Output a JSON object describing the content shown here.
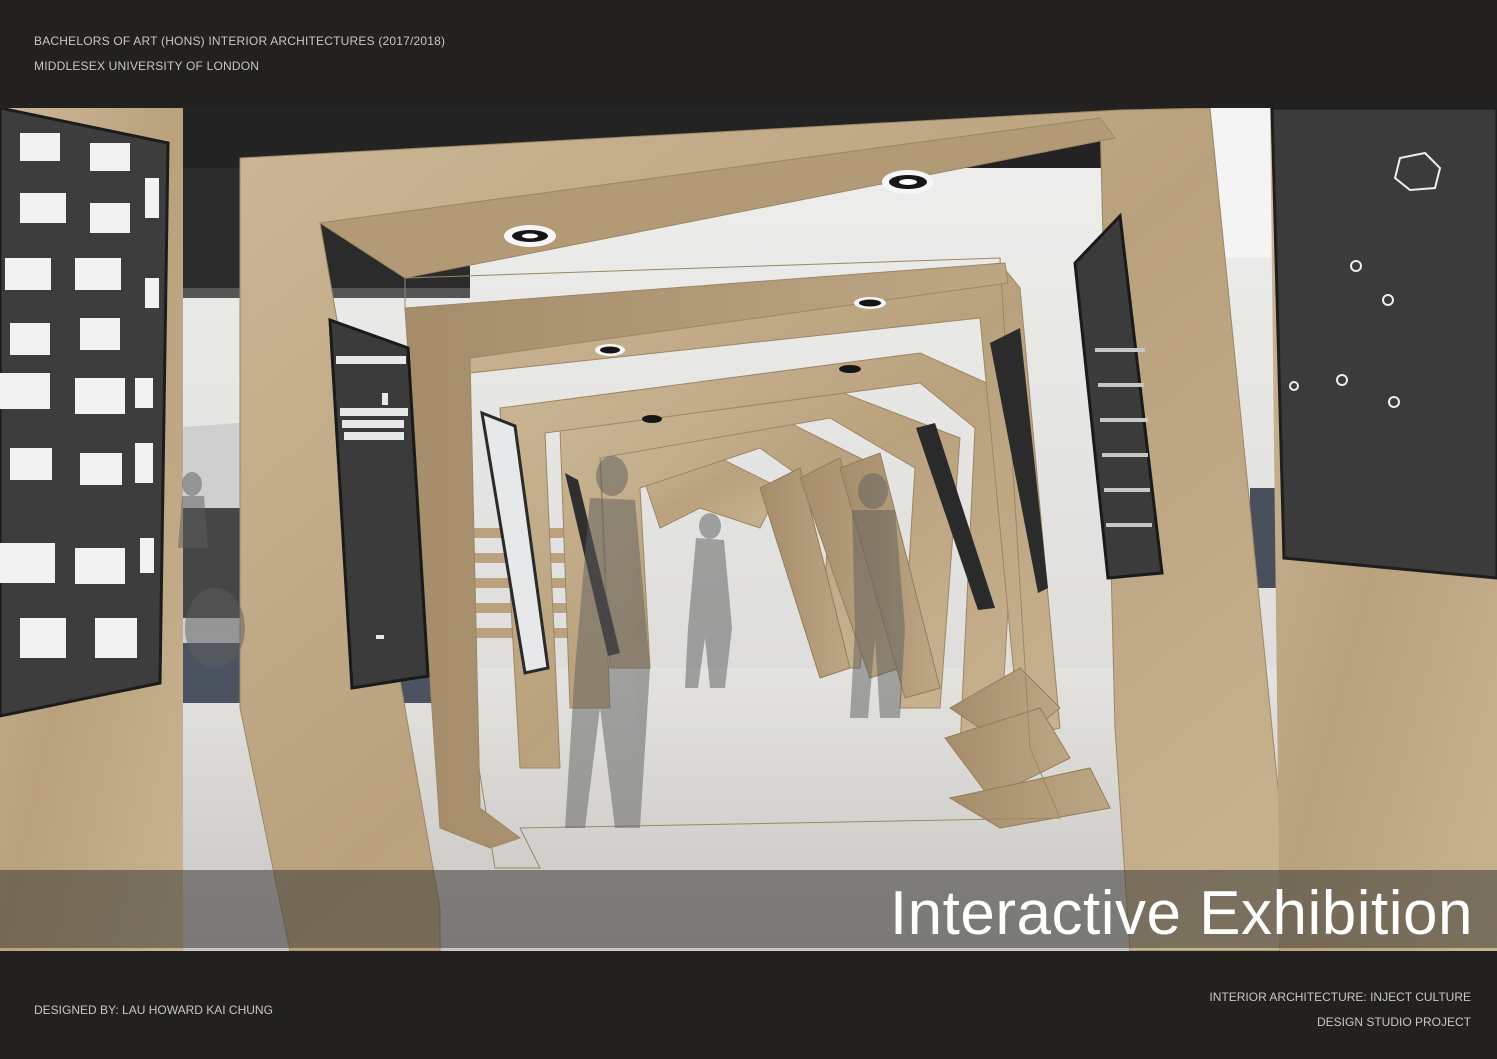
{
  "header": {
    "line1": "BACHELORS OF ART (HONS) INTERIOR ARCHITECTURES (2017/2018)",
    "line2": "MIDDLESEX UNIVERSITY OF LONDON"
  },
  "render": {
    "title": "Interactive Exhibition"
  },
  "footer": {
    "designer": "DESIGNED BY: LAU HOWARD KAI CHUNG",
    "course": "INTERIOR ARCHITECTURE: INJECT CULTURE",
    "project": "DESIGN STUDIO PROJECT"
  },
  "colors": {
    "background": "#222120",
    "wood": "#c3ad8c",
    "floor": "#d2d0cc",
    "panel": "#3a3a3a",
    "pixel_art": "#f2f2f2"
  }
}
